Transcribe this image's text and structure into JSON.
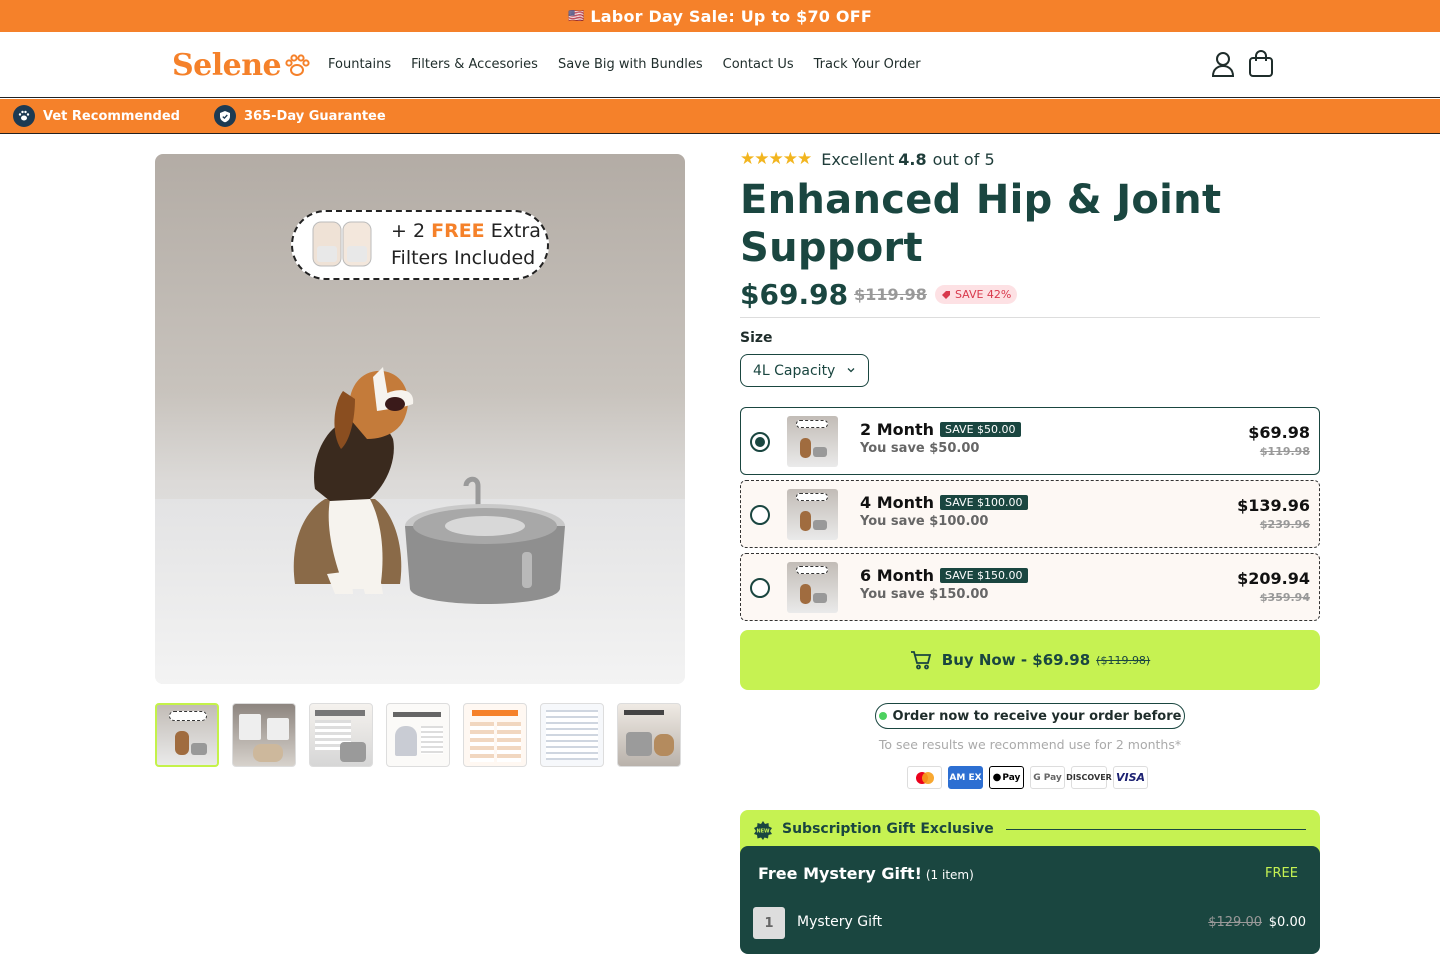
{
  "announcement": {
    "flag": "🇺🇸",
    "text": "Labor Day Sale: Up to $70 OFF",
    "color": "#f5812a"
  },
  "brand": {
    "logo_text": "Selene",
    "color": "#f5812a"
  },
  "nav": {
    "items": [
      "Fountains",
      "Filters & Accesories",
      "Save Big with Bundles",
      "Contact Us",
      "Track Your Order"
    ]
  },
  "header_icons": [
    "account-icon",
    "cart-icon"
  ],
  "trust_bar": [
    {
      "icon": "paw-icon",
      "label": "Vet Recommended"
    },
    {
      "icon": "shield-icon",
      "label": "365-Day Guarantee"
    }
  ],
  "gallery": {
    "badge": {
      "line1_prefix": "+ 2 ",
      "line1_free": "FREE",
      "line1_suffix": " Extra",
      "line2": "Filters Included"
    },
    "thumbnail_count": 7
  },
  "product": {
    "rating_label": "Excellent",
    "rating_value": "4.8",
    "rating_suffix": "out of 5",
    "rating_stars": 4.8,
    "title": "Enhanced Hip & Joint Support",
    "price": "$69.98",
    "compare_price": "$119.98",
    "save_badge": "SAVE 42%"
  },
  "size": {
    "label": "Size",
    "selected": "4L Capacity"
  },
  "options": [
    {
      "name": "2 Month",
      "pill": "SAVE $50.00",
      "you_save": "You save $50.00",
      "price": "$69.98",
      "compare": "$119.98",
      "selected": true
    },
    {
      "name": "4 Month",
      "pill": "SAVE $100.00",
      "you_save": "You save $100.00",
      "price": "$139.96",
      "compare": "$239.96",
      "selected": false
    },
    {
      "name": "6 Month",
      "pill": "SAVE $150.00",
      "you_save": "You save $150.00",
      "price": "$209.94",
      "compare": "$359.94",
      "selected": false
    }
  ],
  "buy_button": {
    "label": "Buy Now - $69.98",
    "compare": "($119.98)",
    "color": "#c6f252"
  },
  "order_note": "Order now to receive your order before",
  "recommend_note": "To see results we recommend use for 2 months*",
  "payments": [
    {
      "name": "mastercard-icon",
      "label": ""
    },
    {
      "name": "amex-icon",
      "label": "AM EX"
    },
    {
      "name": "apple-pay-icon",
      "label": "Pay"
    },
    {
      "name": "google-pay-icon",
      "label": "G Pay"
    },
    {
      "name": "discover-icon",
      "label": "DISCOVER"
    },
    {
      "name": "visa-icon",
      "label": "VISA"
    }
  ],
  "gift": {
    "heading": "Subscription Gift Exclusive",
    "badge_icon": "new-badge-icon",
    "box_title": "Free Mystery Gift!",
    "box_count": "(1 item)",
    "free_label": "FREE",
    "qty": "1",
    "item": "Mystery Gift",
    "old_price": "$129.00",
    "new_price": "$0.00"
  },
  "colors": {
    "dark_green": "#1a4640",
    "lime": "#c6f252",
    "orange": "#f5812a"
  }
}
